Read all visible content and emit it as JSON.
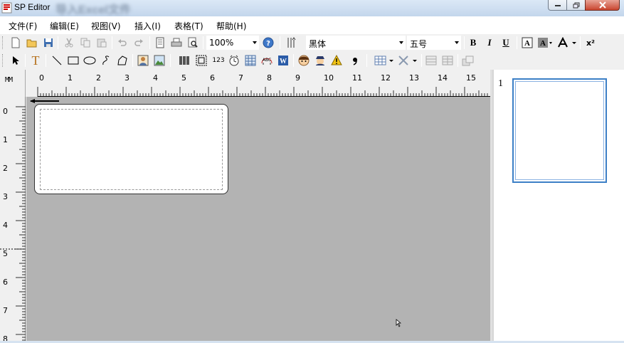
{
  "window": {
    "title": "SP Editor",
    "blurred_caption": "导入Excel文件"
  },
  "menu": [
    "文件(F)",
    "编辑(E)",
    "视图(V)",
    "插入(I)",
    "表格(T)",
    "帮助(H)"
  ],
  "toolbar1": {
    "zoom": "100%",
    "font": "黑体",
    "font_size": "五号",
    "bold": "B",
    "italic": "I",
    "underline": "U",
    "superscript": "x²"
  },
  "toolbar2": {
    "text_tool": "T",
    "number_tool": "123"
  },
  "ruler": {
    "corner_unit": "MM",
    "horizontal": [
      "0",
      "1",
      "2",
      "3",
      "4",
      "5",
      "6",
      "7",
      "8",
      "9",
      "10",
      "11",
      "12",
      "13",
      "14",
      "15"
    ],
    "vertical": [
      "0",
      "1",
      "2",
      "3",
      "4",
      "5",
      "6",
      "7",
      "8"
    ]
  },
  "pages_panel": {
    "page_number": "1"
  }
}
